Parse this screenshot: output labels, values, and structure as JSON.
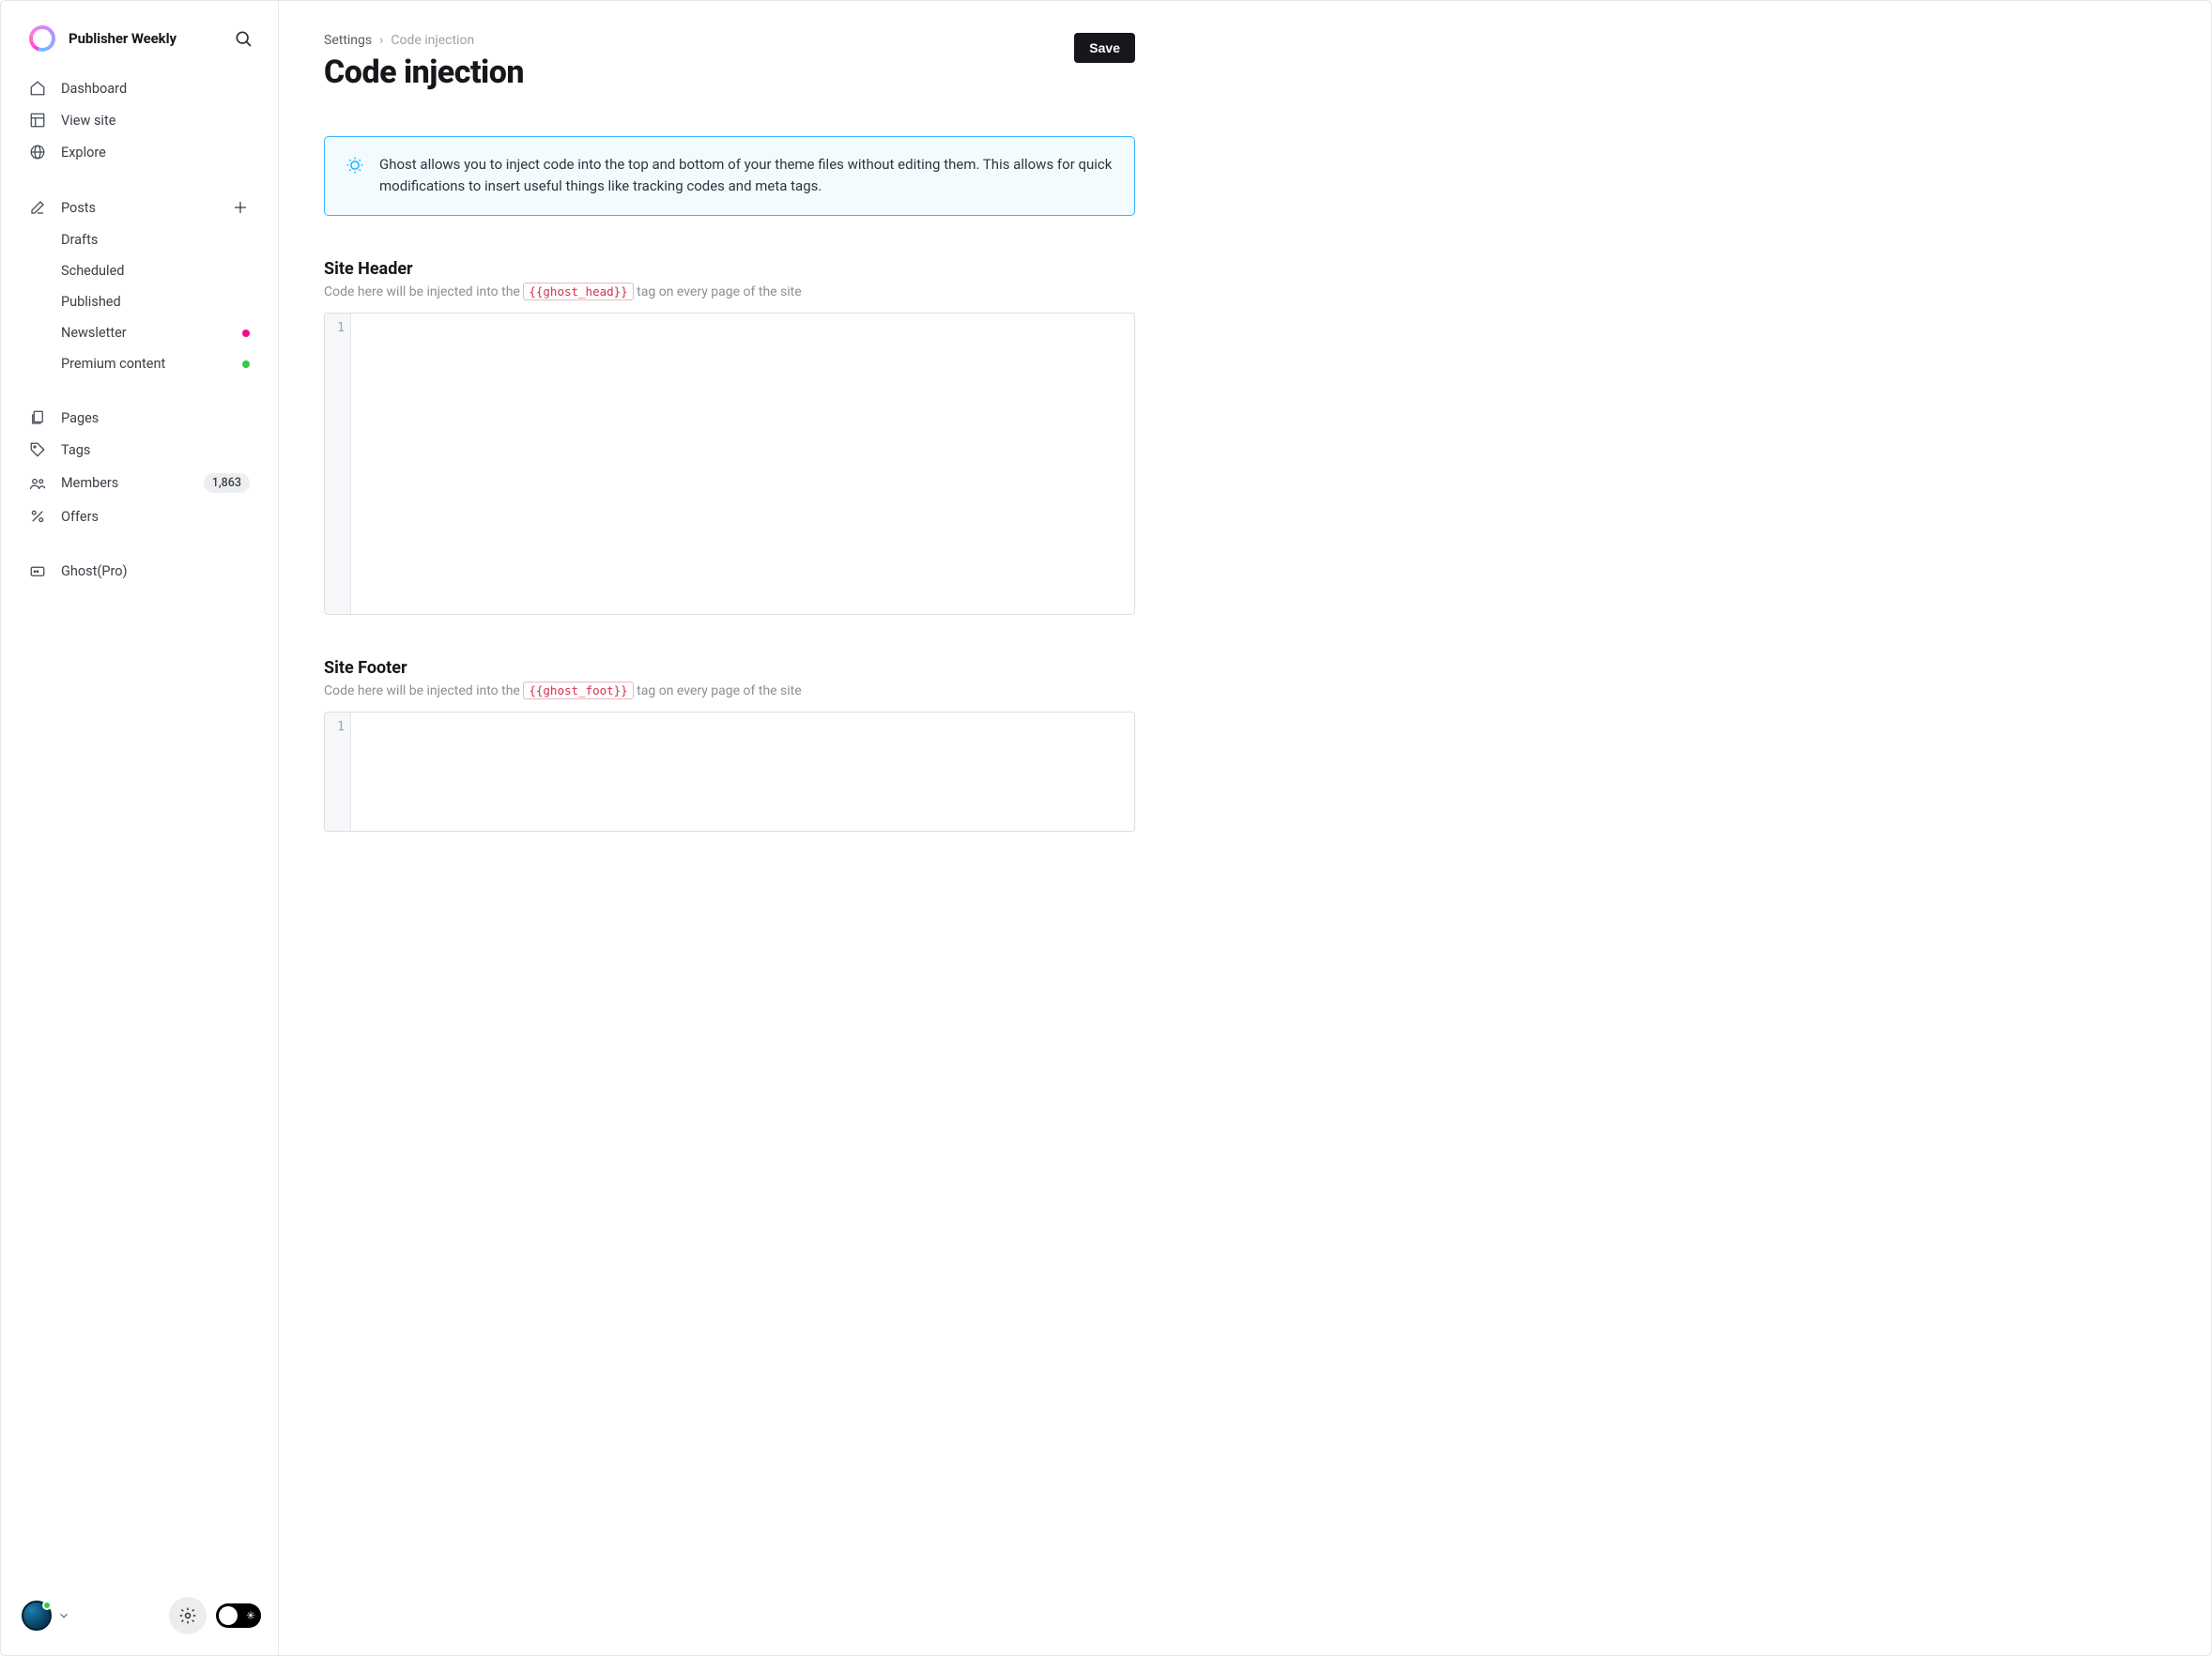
{
  "brand": {
    "name": "Publisher Weekly"
  },
  "nav_top": [
    {
      "label": "Dashboard",
      "icon": "home"
    },
    {
      "label": "View site",
      "icon": "layout"
    },
    {
      "label": "Explore",
      "icon": "globe"
    }
  ],
  "posts": {
    "label": "Posts",
    "children": [
      {
        "label": "Drafts",
        "dot": null
      },
      {
        "label": "Scheduled",
        "dot": null
      },
      {
        "label": "Published",
        "dot": null
      },
      {
        "label": "Newsletter",
        "dot": "pink"
      },
      {
        "label": "Premium content",
        "dot": "green"
      }
    ]
  },
  "nav_lower": [
    {
      "label": "Pages",
      "icon": "copy",
      "count": null
    },
    {
      "label": "Tags",
      "icon": "tag",
      "count": null
    },
    {
      "label": "Members",
      "icon": "users",
      "count": "1,863"
    },
    {
      "label": "Offers",
      "icon": "percent",
      "count": null
    }
  ],
  "nav_pro": {
    "label": "Ghost(Pro)"
  },
  "breadcrumb": {
    "root": "Settings",
    "current": "Code injection"
  },
  "page_title": "Code injection",
  "save_label": "Save",
  "banner_text": "Ghost allows you to inject code into the top and bottom of your theme files without editing them. This allows for quick modifications to insert useful things like tracking codes and meta tags.",
  "header_section": {
    "title": "Site Header",
    "desc_before": "Code here will be injected into the ",
    "tag": "{{ghost_head}}",
    "desc_after": " tag on every page of the site",
    "gutter_first": "1",
    "value": ""
  },
  "footer_section": {
    "title": "Site Footer",
    "desc_before": "Code here will be injected into the ",
    "tag": "{{ghost_foot}}",
    "desc_after": " tag on every page of the site",
    "gutter_first": "1",
    "value": ""
  }
}
